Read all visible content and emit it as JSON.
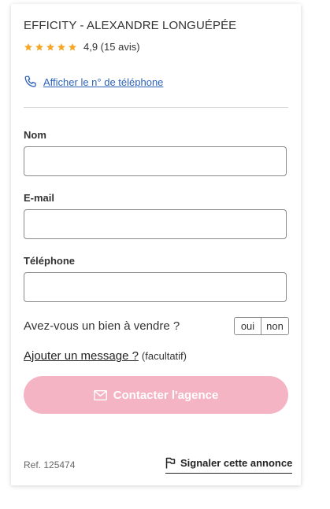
{
  "agency": {
    "name": "EFFICITY - ALEXANDRE LONGUÉPÉE",
    "rating_text": "4,9 (15 avis)",
    "rating_value": 4.9,
    "star_color": "#f5a623"
  },
  "phone": {
    "label": "Afficher le n° de téléphone",
    "icon": "phone-icon"
  },
  "form": {
    "name_label": "Nom",
    "email_label": "E-mail",
    "phone_label": "Téléphone",
    "property_question": "Avez-vous un bien à vendre ?",
    "yes_label": "oui",
    "no_label": "non",
    "add_message": "Ajouter un message ?",
    "optional": "(facultatif)"
  },
  "cta": {
    "label": "Contacter l'agence",
    "icon": "envelope-icon",
    "color": "#f5b4c4"
  },
  "footer": {
    "ref": "Ref. 125474",
    "report_label": "Signaler cette annonce",
    "report_icon": "flag-icon"
  }
}
